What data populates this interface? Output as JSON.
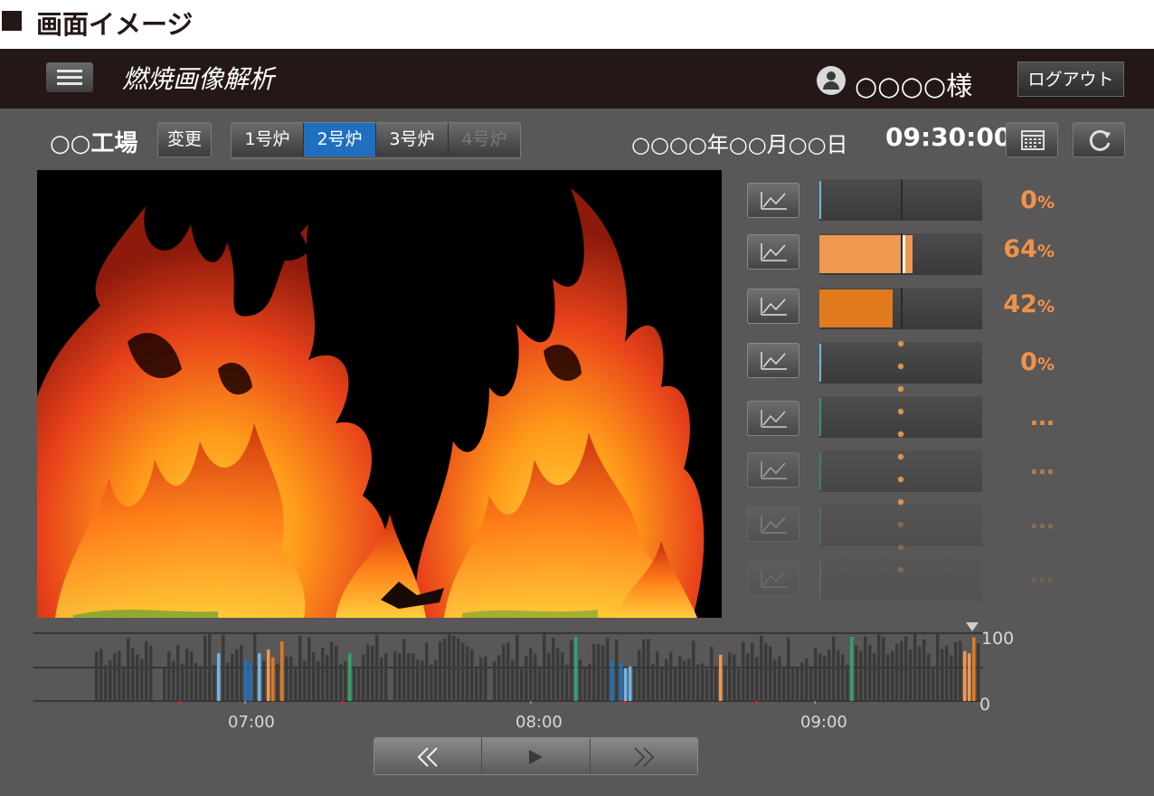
{
  "page_heading": "画面イメージ",
  "header": {
    "app_title": "燃焼画像解析",
    "user_name": "○○○○様",
    "logout_label": "ログアウト"
  },
  "toolbar": {
    "factory_name": "○○工場",
    "change_label": "変更",
    "furnaces": [
      {
        "label": "1号炉",
        "state": "normal"
      },
      {
        "label": "2号炉",
        "state": "active"
      },
      {
        "label": "3号炉",
        "state": "normal"
      },
      {
        "label": "4号炉",
        "state": "disabled"
      }
    ],
    "date": "○○○○年○○月○○日",
    "time": "09:30:00"
  },
  "metrics": [
    {
      "value": "0",
      "unit": "%",
      "level": 0,
      "marker": 0.5,
      "color": "#6fb6e6"
    },
    {
      "value": "64",
      "unit": "%",
      "level": 0.57,
      "marker": 0.5,
      "color": "#f0984f"
    },
    {
      "value": "42",
      "unit": "%",
      "level": 0.45,
      "marker": 0.5,
      "color": "#e17a1d"
    },
    {
      "value": "0",
      "unit": "%",
      "level": 0,
      "marker": 0.5,
      "color": "#6fb6e6"
    },
    {
      "value": "…",
      "unit": "",
      "level": 0,
      "marker": 0.5,
      "color": "#2fa36b"
    },
    {
      "value": "…",
      "unit": "",
      "level": 0,
      "marker": 0.5,
      "color": "#2fa36b"
    },
    {
      "value": "…",
      "unit": "",
      "level": 0,
      "marker": 0.5,
      "color": "#2fa36b"
    },
    {
      "value": "…",
      "unit": "",
      "level": 0,
      "marker": 0.5,
      "color": "#6fb6e6"
    }
  ],
  "timeline": {
    "y_max_label": "100",
    "y_min_label": "0",
    "time_labels": [
      "07:00",
      "08:00",
      "09:00"
    ]
  },
  "playback": {
    "rewind_icon": "double-chevron-left-icon",
    "play_icon": "play-icon",
    "forward_icon": "double-chevron-right-icon"
  },
  "colors": {
    "accent_blue": "#1f6fc0",
    "value_orange": "#f0934a",
    "flame_orange": "#e8621a"
  }
}
